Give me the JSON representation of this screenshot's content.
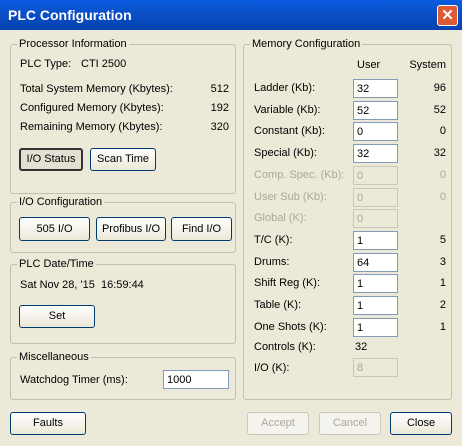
{
  "window": {
    "title": "PLC Configuration"
  },
  "processor": {
    "legend": "Processor Information",
    "plc_type_label": "PLC Type:",
    "plc_type_value": "CTI 2500",
    "rows": [
      {
        "label": "Total System Memory (Kbytes):",
        "value": "512"
      },
      {
        "label": "Configured Memory (Kbytes):",
        "value": "192"
      },
      {
        "label": "Remaining Memory (Kbytes):",
        "value": "320"
      }
    ],
    "io_status_label": "I/O Status",
    "scan_time_label": "Scan Time"
  },
  "io_config": {
    "legend": "I/O Configuration",
    "buttons": [
      "505 I/O",
      "Profibus I/O",
      "Find I/O"
    ]
  },
  "datetime": {
    "legend": "PLC Date/Time",
    "value": "Sat Nov 28, '15  16:59:44",
    "set_label": "Set"
  },
  "misc": {
    "legend": "Miscellaneous",
    "watchdog_label": "Watchdog Timer (ms):",
    "watchdog_value": "1000"
  },
  "memory": {
    "legend": "Memory Configuration",
    "col_user": "User",
    "col_system": "System",
    "rows": [
      {
        "label": "Ladder (Kb):",
        "user": "32",
        "system": "96",
        "disabled": false
      },
      {
        "label": "Variable (Kb):",
        "user": "52",
        "system": "52",
        "disabled": false
      },
      {
        "label": "Constant (Kb):",
        "user": "0",
        "system": "0",
        "disabled": false
      },
      {
        "label": "Special (Kb):",
        "user": "32",
        "system": "32",
        "disabled": false
      },
      {
        "label": "Comp. Spec. (Kb):",
        "user": "0",
        "system": "0",
        "disabled": true
      },
      {
        "label": "User Sub (Kb):",
        "user": "0",
        "system": "0",
        "disabled": true
      },
      {
        "label": "Global (K):",
        "user": "0",
        "system": "",
        "disabled": true
      },
      {
        "label": "T/C (K):",
        "user": "1",
        "system": "5",
        "disabled": false
      },
      {
        "label": "Drums:",
        "user": "64",
        "system": "3",
        "disabled": false
      },
      {
        "label": "Shift Reg (K):",
        "user": "1",
        "system": "1",
        "disabled": false
      },
      {
        "label": "Table (K):",
        "user": "1",
        "system": "2",
        "disabled": false
      },
      {
        "label": "One Shots (K):",
        "user": "1",
        "system": "1",
        "disabled": false
      }
    ],
    "controls_label": "Controls (K):",
    "controls_value": "32",
    "io_label": "I/O (K):",
    "io_value": "8"
  },
  "footer": {
    "faults": "Faults",
    "accept": "Accept",
    "cancel": "Cancel",
    "close": "Close"
  }
}
